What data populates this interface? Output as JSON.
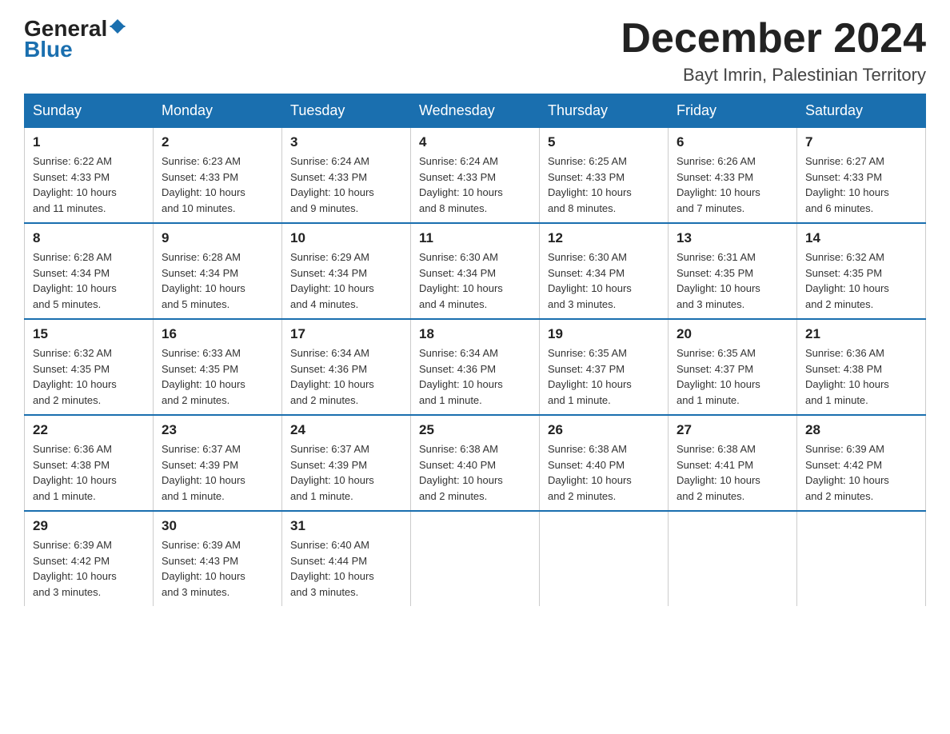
{
  "header": {
    "logo": {
      "text_general": "General",
      "text_blue": "Blue"
    },
    "title": "December 2024",
    "subtitle": "Bayt Imrin, Palestinian Territory"
  },
  "weekdays": [
    "Sunday",
    "Monday",
    "Tuesday",
    "Wednesday",
    "Thursday",
    "Friday",
    "Saturday"
  ],
  "weeks": [
    [
      {
        "day": "1",
        "sunrise": "6:22 AM",
        "sunset": "4:33 PM",
        "daylight": "10 hours and 11 minutes."
      },
      {
        "day": "2",
        "sunrise": "6:23 AM",
        "sunset": "4:33 PM",
        "daylight": "10 hours and 10 minutes."
      },
      {
        "day": "3",
        "sunrise": "6:24 AM",
        "sunset": "4:33 PM",
        "daylight": "10 hours and 9 minutes."
      },
      {
        "day": "4",
        "sunrise": "6:24 AM",
        "sunset": "4:33 PM",
        "daylight": "10 hours and 8 minutes."
      },
      {
        "day": "5",
        "sunrise": "6:25 AM",
        "sunset": "4:33 PM",
        "daylight": "10 hours and 8 minutes."
      },
      {
        "day": "6",
        "sunrise": "6:26 AM",
        "sunset": "4:33 PM",
        "daylight": "10 hours and 7 minutes."
      },
      {
        "day": "7",
        "sunrise": "6:27 AM",
        "sunset": "4:33 PM",
        "daylight": "10 hours and 6 minutes."
      }
    ],
    [
      {
        "day": "8",
        "sunrise": "6:28 AM",
        "sunset": "4:34 PM",
        "daylight": "10 hours and 5 minutes."
      },
      {
        "day": "9",
        "sunrise": "6:28 AM",
        "sunset": "4:34 PM",
        "daylight": "10 hours and 5 minutes."
      },
      {
        "day": "10",
        "sunrise": "6:29 AM",
        "sunset": "4:34 PM",
        "daylight": "10 hours and 4 minutes."
      },
      {
        "day": "11",
        "sunrise": "6:30 AM",
        "sunset": "4:34 PM",
        "daylight": "10 hours and 4 minutes."
      },
      {
        "day": "12",
        "sunrise": "6:30 AM",
        "sunset": "4:34 PM",
        "daylight": "10 hours and 3 minutes."
      },
      {
        "day": "13",
        "sunrise": "6:31 AM",
        "sunset": "4:35 PM",
        "daylight": "10 hours and 3 minutes."
      },
      {
        "day": "14",
        "sunrise": "6:32 AM",
        "sunset": "4:35 PM",
        "daylight": "10 hours and 2 minutes."
      }
    ],
    [
      {
        "day": "15",
        "sunrise": "6:32 AM",
        "sunset": "4:35 PM",
        "daylight": "10 hours and 2 minutes."
      },
      {
        "day": "16",
        "sunrise": "6:33 AM",
        "sunset": "4:35 PM",
        "daylight": "10 hours and 2 minutes."
      },
      {
        "day": "17",
        "sunrise": "6:34 AM",
        "sunset": "4:36 PM",
        "daylight": "10 hours and 2 minutes."
      },
      {
        "day": "18",
        "sunrise": "6:34 AM",
        "sunset": "4:36 PM",
        "daylight": "10 hours and 1 minute."
      },
      {
        "day": "19",
        "sunrise": "6:35 AM",
        "sunset": "4:37 PM",
        "daylight": "10 hours and 1 minute."
      },
      {
        "day": "20",
        "sunrise": "6:35 AM",
        "sunset": "4:37 PM",
        "daylight": "10 hours and 1 minute."
      },
      {
        "day": "21",
        "sunrise": "6:36 AM",
        "sunset": "4:38 PM",
        "daylight": "10 hours and 1 minute."
      }
    ],
    [
      {
        "day": "22",
        "sunrise": "6:36 AM",
        "sunset": "4:38 PM",
        "daylight": "10 hours and 1 minute."
      },
      {
        "day": "23",
        "sunrise": "6:37 AM",
        "sunset": "4:39 PM",
        "daylight": "10 hours and 1 minute."
      },
      {
        "day": "24",
        "sunrise": "6:37 AM",
        "sunset": "4:39 PM",
        "daylight": "10 hours and 1 minute."
      },
      {
        "day": "25",
        "sunrise": "6:38 AM",
        "sunset": "4:40 PM",
        "daylight": "10 hours and 2 minutes."
      },
      {
        "day": "26",
        "sunrise": "6:38 AM",
        "sunset": "4:40 PM",
        "daylight": "10 hours and 2 minutes."
      },
      {
        "day": "27",
        "sunrise": "6:38 AM",
        "sunset": "4:41 PM",
        "daylight": "10 hours and 2 minutes."
      },
      {
        "day": "28",
        "sunrise": "6:39 AM",
        "sunset": "4:42 PM",
        "daylight": "10 hours and 2 minutes."
      }
    ],
    [
      {
        "day": "29",
        "sunrise": "6:39 AM",
        "sunset": "4:42 PM",
        "daylight": "10 hours and 3 minutes."
      },
      {
        "day": "30",
        "sunrise": "6:39 AM",
        "sunset": "4:43 PM",
        "daylight": "10 hours and 3 minutes."
      },
      {
        "day": "31",
        "sunrise": "6:40 AM",
        "sunset": "4:44 PM",
        "daylight": "10 hours and 3 minutes."
      },
      null,
      null,
      null,
      null
    ]
  ],
  "labels": {
    "sunrise": "Sunrise:",
    "sunset": "Sunset:",
    "daylight": "Daylight:"
  }
}
